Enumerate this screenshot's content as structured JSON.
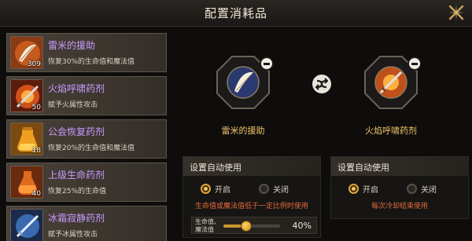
{
  "header": {
    "title": "配置消耗品"
  },
  "items": [
    {
      "name": "雷米的援助",
      "desc": "恢复30%的生命值和魔法值",
      "count": "309",
      "icon": "feather-scroll-icon"
    },
    {
      "name": "火焰呼啸药剂",
      "desc": "赋予火属性攻击",
      "count": "50",
      "icon": "fire-sword-icon"
    },
    {
      "name": "公会恢复药剂",
      "desc": "恢复20%的生命值和魔法值",
      "count": "18",
      "icon": "guild-potion-icon"
    },
    {
      "name": "上级生命药剂",
      "desc": "恢复25%的生命值",
      "count": "40",
      "icon": "life-potion-icon"
    },
    {
      "name": "冰霜寂静药剂",
      "desc": "赋予冰属性攻击",
      "count": "",
      "icon": "ice-sword-icon"
    }
  ],
  "slots": [
    {
      "label": "雷米的援助",
      "icon": "feather-scroll-icon"
    },
    {
      "label": "火焰呼啸药剂",
      "icon": "fire-sword-icon"
    }
  ],
  "auto_left": {
    "title": "设置自动使用",
    "on_label": "开启",
    "off_label": "关闭",
    "selected": "on",
    "note": "生命值或魔法值低于一定比例时使用",
    "slider_label": "生命值、\n魔法值",
    "slider_value": "40%",
    "slider_fraction": 0.4
  },
  "auto_right": {
    "title": "设置自动使用",
    "on_label": "开启",
    "off_label": "关闭",
    "selected": "on",
    "note": "每次冷却结束使用"
  },
  "colors": {
    "accent": "#f0c46a",
    "item_name": "#c79bff",
    "warning": "#e26a3a"
  }
}
